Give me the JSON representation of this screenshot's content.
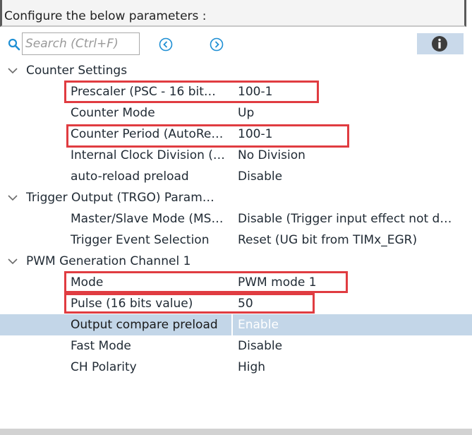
{
  "header": {
    "title": "Configure the below parameters :"
  },
  "toolbar": {
    "search_placeholder": "Search (Ctrl+F)",
    "search_value": "",
    "icons": [
      "search-icon",
      "previous-icon",
      "next-icon",
      "info-icon"
    ]
  },
  "colors": {
    "selection": "#c3d6e8",
    "highlight_box": "#e03c41",
    "icon_blue": "#1e8fd4",
    "info_button": "#c9d9ea"
  },
  "groups": [
    {
      "label": "Counter Settings",
      "expanded": true,
      "params": [
        {
          "name": "Prescaler (PSC - 16 bit…",
          "value": "100-1",
          "highlighted": true
        },
        {
          "name": "Counter Mode",
          "value": "Up"
        },
        {
          "name": "Counter Period (AutoRe…",
          "value": "100-1",
          "highlighted": true
        },
        {
          "name": "Internal Clock Division (…",
          "value": "No Division"
        },
        {
          "name": "auto-reload preload",
          "value": "Disable"
        }
      ]
    },
    {
      "label": "Trigger Output (TRGO) Param…",
      "expanded": true,
      "params": [
        {
          "name": "Master/Slave Mode (MS…",
          "value": "Disable (Trigger input effect not d…"
        },
        {
          "name": "Trigger Event Selection",
          "value": "Reset (UG bit from TIMx_EGR)"
        }
      ]
    },
    {
      "label": "PWM Generation Channel 1",
      "expanded": true,
      "params": [
        {
          "name": "Mode",
          "value": "PWM mode 1",
          "highlighted": true
        },
        {
          "name": "Pulse (16 bits value)",
          "value": "50",
          "highlighted": true
        },
        {
          "name": "Output compare preload",
          "value": "Enable",
          "selected": true
        },
        {
          "name": "Fast Mode",
          "value": "Disable"
        },
        {
          "name": "CH Polarity",
          "value": "High"
        }
      ]
    }
  ]
}
